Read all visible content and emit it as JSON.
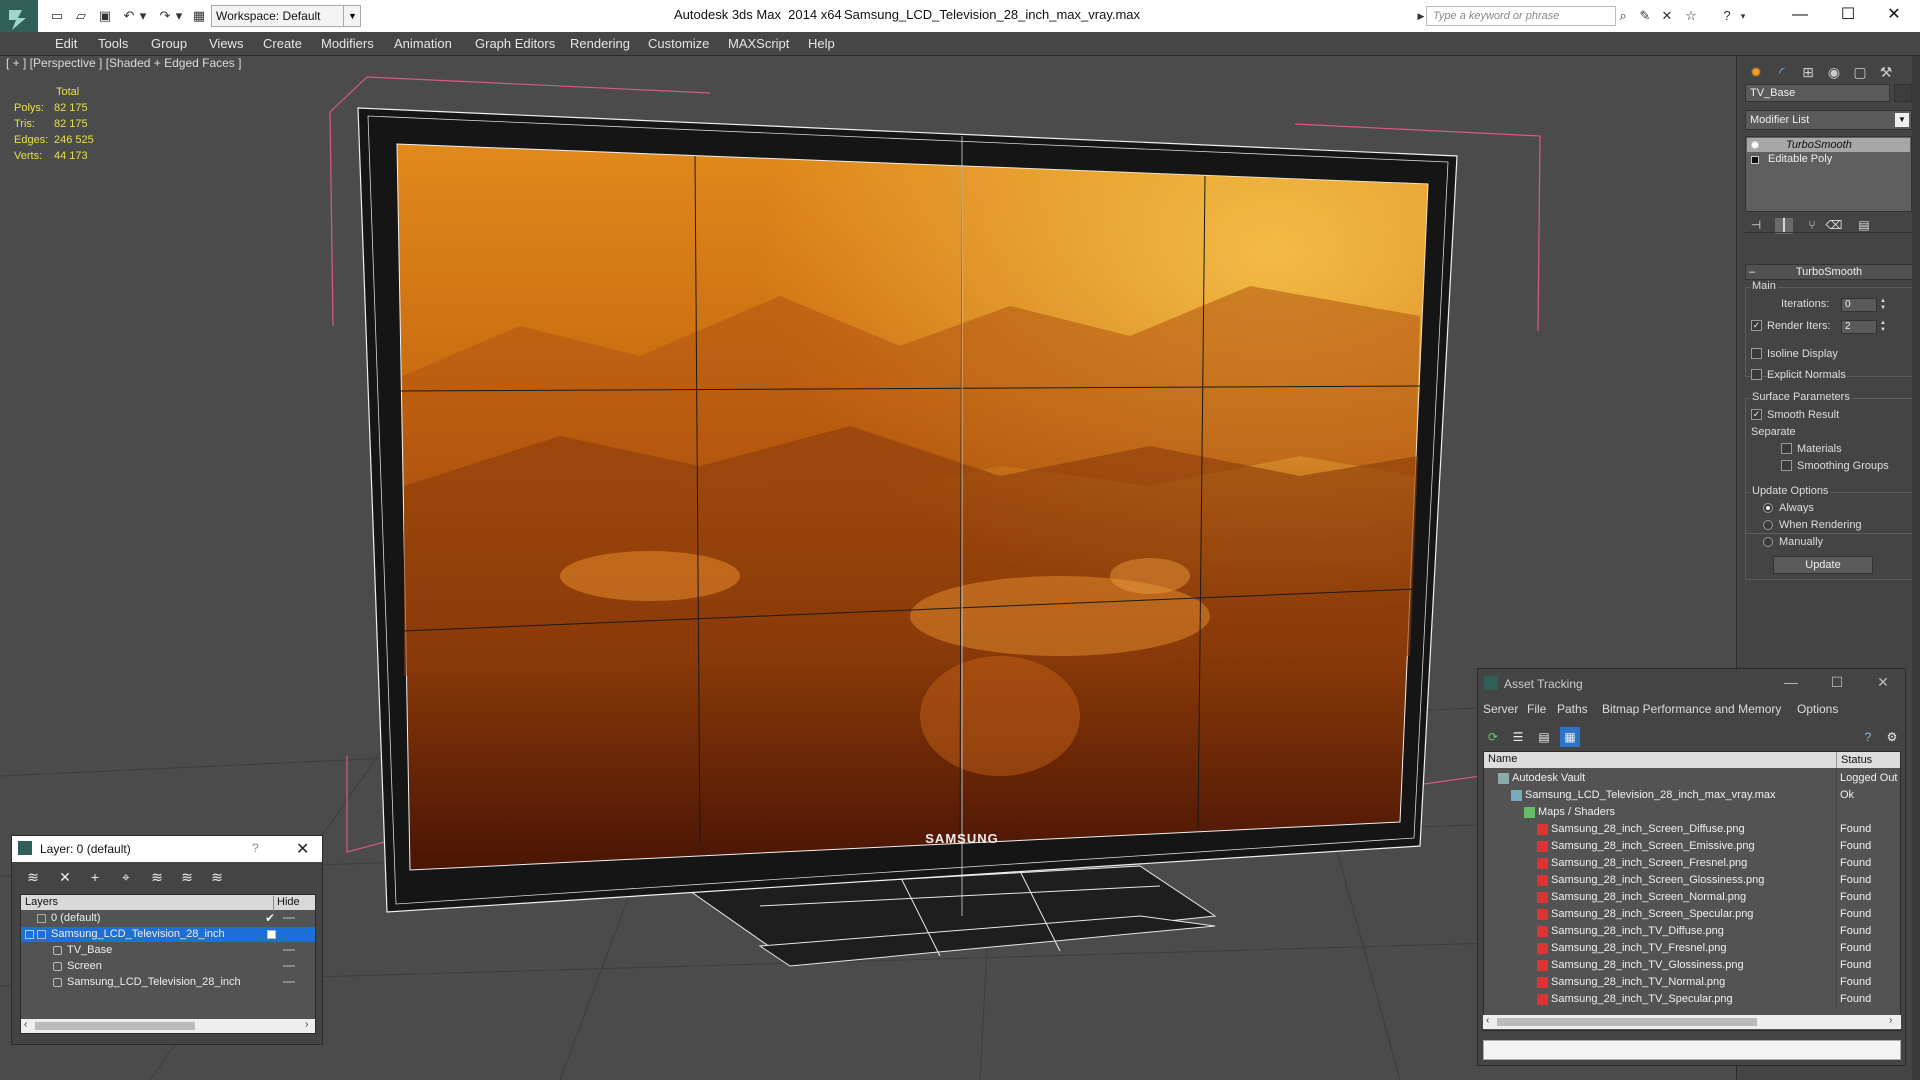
{
  "titlebar": {
    "workspace": "Workspace: Default",
    "app_title": "Autodesk 3ds Max  2014 x64",
    "doc_title": "Samsung_LCD_Television_28_inch_max_vray.max",
    "search_placeholder": "Type a keyword or phrase"
  },
  "menu": [
    "Edit",
    "Tools",
    "Group",
    "Views",
    "Create",
    "Modifiers",
    "Animation",
    "Graph Editors",
    "Rendering",
    "Customize",
    "MAXScript",
    "Help"
  ],
  "viewport": {
    "label": "[ + ] [Perspective ] [Shaded + Edged Faces ]",
    "stats": {
      "header": "Total",
      "rows": [
        {
          "k": "Polys:",
          "v": "82 175"
        },
        {
          "k": "Tris:",
          "v": "82 175"
        },
        {
          "k": "Edges:",
          "v": "246 525"
        },
        {
          "k": "Verts:",
          "v": "44 173"
        }
      ]
    },
    "logo": "SAMSUNG",
    "colors": {
      "screen_top": "#d07a18",
      "screen_bottom": "#5a1a06",
      "bezel": "#1a1a1a",
      "wire": "#f0f0f0",
      "bbox": "#d8588a",
      "grid": "#3a3a3a"
    }
  },
  "command_panel": {
    "object_name": "TV_Base",
    "modifier_list": "Modifier List",
    "stack": [
      "TurboSmooth",
      "Editable Poly"
    ],
    "rollout_title": "TurboSmooth",
    "main_group": "Main",
    "iterations_label": "Iterations:",
    "iterations_value": "0",
    "render_iters_label": "Render Iters:",
    "render_iters_value": "2",
    "render_iters_checked": true,
    "isoline_label": "Isoline Display",
    "explicit_label": "Explicit Normals",
    "surface_group": "Surface Parameters",
    "smooth_result_label": "Smooth Result",
    "separate_label": "Separate",
    "materials_label": "Materials",
    "smoothing_groups_label": "Smoothing Groups",
    "update_group": "Update Options",
    "always_label": "Always",
    "when_rendering_label": "When Rendering",
    "manually_label": "Manually",
    "update_button": "Update"
  },
  "layer_dialog": {
    "title": "Layer: 0 (default)",
    "help": "?",
    "col_layers": "Layers",
    "col_hide": "Hide",
    "rows": [
      {
        "label": "0 (default)",
        "indent": 0,
        "selected": false
      },
      {
        "label": "Samsung_LCD_Television_28_inch",
        "indent": 0,
        "selected": true
      },
      {
        "label": "TV_Base",
        "indent": 1,
        "selected": false
      },
      {
        "label": "Screen",
        "indent": 1,
        "selected": false
      },
      {
        "label": "Samsung_LCD_Television_28_inch",
        "indent": 1,
        "selected": false
      }
    ]
  },
  "asset_tracking": {
    "title": "Asset Tracking",
    "menu": [
      "Server",
      "File",
      "Paths",
      "Bitmap Performance and Memory",
      "Options"
    ],
    "col_name": "Name",
    "col_status": "Status",
    "rows": [
      {
        "name": "Autodesk Vault",
        "status": "Logged Out",
        "indent": 0,
        "icon": "vault-icon"
      },
      {
        "name": "Samsung_LCD_Television_28_inch_max_vray.max",
        "status": "Ok",
        "indent": 1,
        "icon": "max-file-icon"
      },
      {
        "name": "Maps / Shaders",
        "status": "",
        "indent": 2,
        "icon": "maps-icon"
      },
      {
        "name": "Samsung_28_inch_Screen_Diffuse.png",
        "status": "Found",
        "indent": 3,
        "icon": "png-icon"
      },
      {
        "name": "Samsung_28_inch_Screen_Emissive.png",
        "status": "Found",
        "indent": 3,
        "icon": "png-icon"
      },
      {
        "name": "Samsung_28_inch_Screen_Fresnel.png",
        "status": "Found",
        "indent": 3,
        "icon": "png-icon"
      },
      {
        "name": "Samsung_28_inch_Screen_Glossiness.png",
        "status": "Found",
        "indent": 3,
        "icon": "png-icon"
      },
      {
        "name": "Samsung_28_inch_Screen_Normal.png",
        "status": "Found",
        "indent": 3,
        "icon": "png-icon"
      },
      {
        "name": "Samsung_28_inch_Screen_Specular.png",
        "status": "Found",
        "indent": 3,
        "icon": "png-icon"
      },
      {
        "name": "Samsung_28_inch_TV_Diffuse.png",
        "status": "Found",
        "indent": 3,
        "icon": "png-icon"
      },
      {
        "name": "Samsung_28_inch_TV_Fresnel.png",
        "status": "Found",
        "indent": 3,
        "icon": "png-icon"
      },
      {
        "name": "Samsung_28_inch_TV_Glossiness.png",
        "status": "Found",
        "indent": 3,
        "icon": "png-icon"
      },
      {
        "name": "Samsung_28_inch_TV_Normal.png",
        "status": "Found",
        "indent": 3,
        "icon": "png-icon"
      },
      {
        "name": "Samsung_28_inch_TV_Specular.png",
        "status": "Found",
        "indent": 3,
        "icon": "png-icon"
      }
    ]
  }
}
